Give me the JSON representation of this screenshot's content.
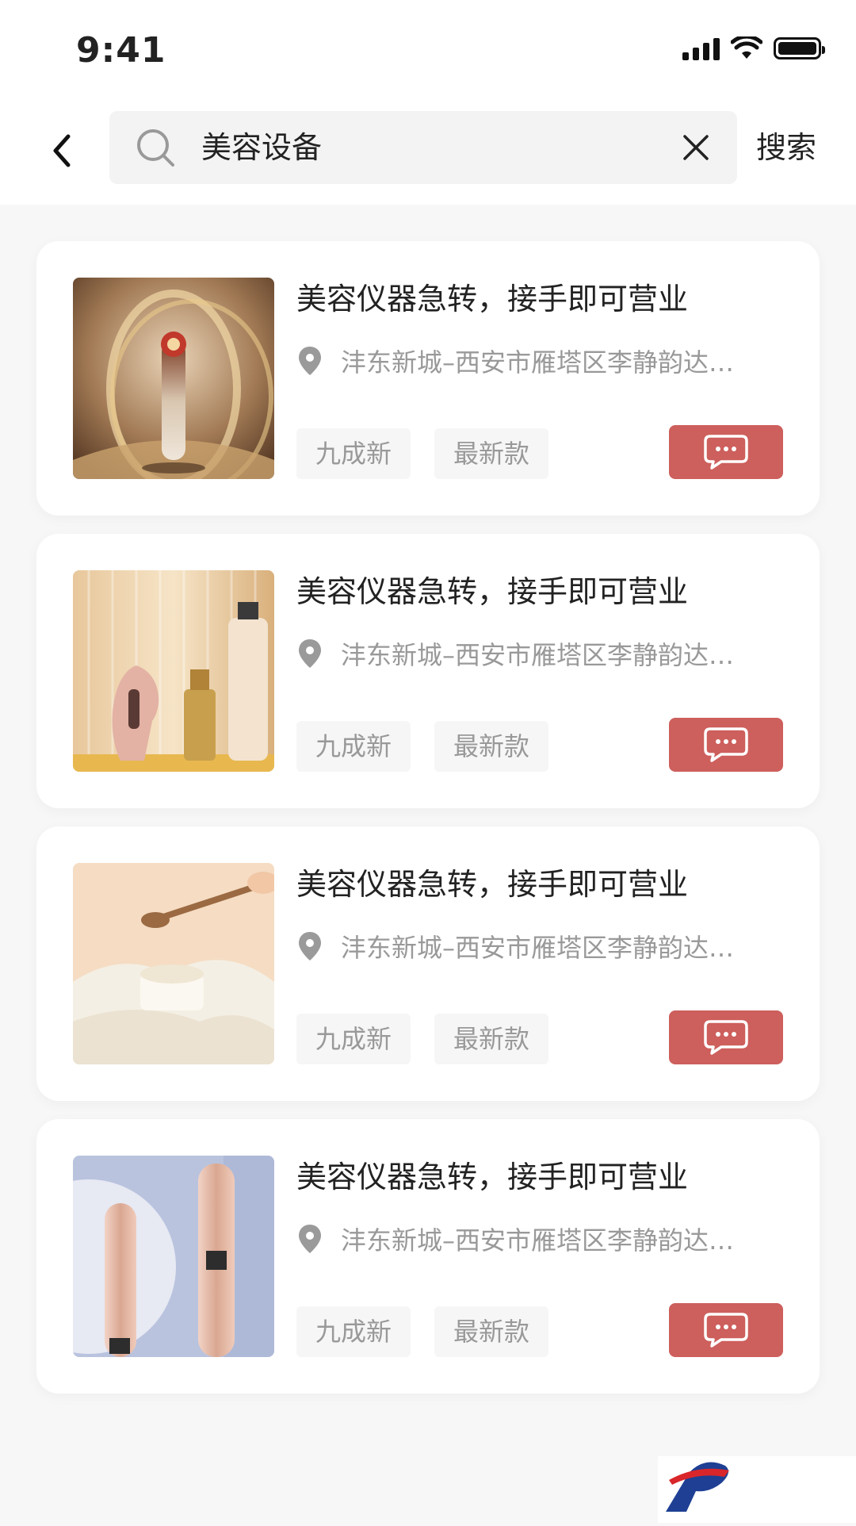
{
  "status_bar": {
    "time": "9:41"
  },
  "header": {
    "search_value": "美容设备",
    "search_button_label": "搜索"
  },
  "listings": [
    {
      "title": "美容仪器急转，接手即可营业",
      "address": "沣东新城–西安市雁塔区李静韵达…",
      "tags": [
        "九成新",
        "最新款"
      ],
      "image": "gold-facial-device"
    },
    {
      "title": "美容仪器急转，接手即可营业",
      "address": "沣东新城–西安市雁塔区李静韵达…",
      "tags": [
        "九成新",
        "最新款"
      ],
      "image": "pink-device-with-bottles"
    },
    {
      "title": "美容仪器急转，接手即可营业",
      "address": "沣东新城–西安市雁塔区李静韵达…",
      "tags": [
        "九成新",
        "最新款"
      ],
      "image": "powder-and-spoon"
    },
    {
      "title": "美容仪器急转，接手即可营业",
      "address": "沣东新城–西安市雁塔区李静韵达…",
      "tags": [
        "九成新",
        "最新款"
      ],
      "image": "pink-beauty-pens"
    }
  ],
  "colors": {
    "accent": "#cd5f5c",
    "background": "#f7f7f7",
    "card": "#ffffff",
    "muted_text": "#999999"
  },
  "icons": [
    "back-icon",
    "search-icon",
    "clear-icon",
    "location-pin-icon",
    "chat-bubble-icon"
  ]
}
